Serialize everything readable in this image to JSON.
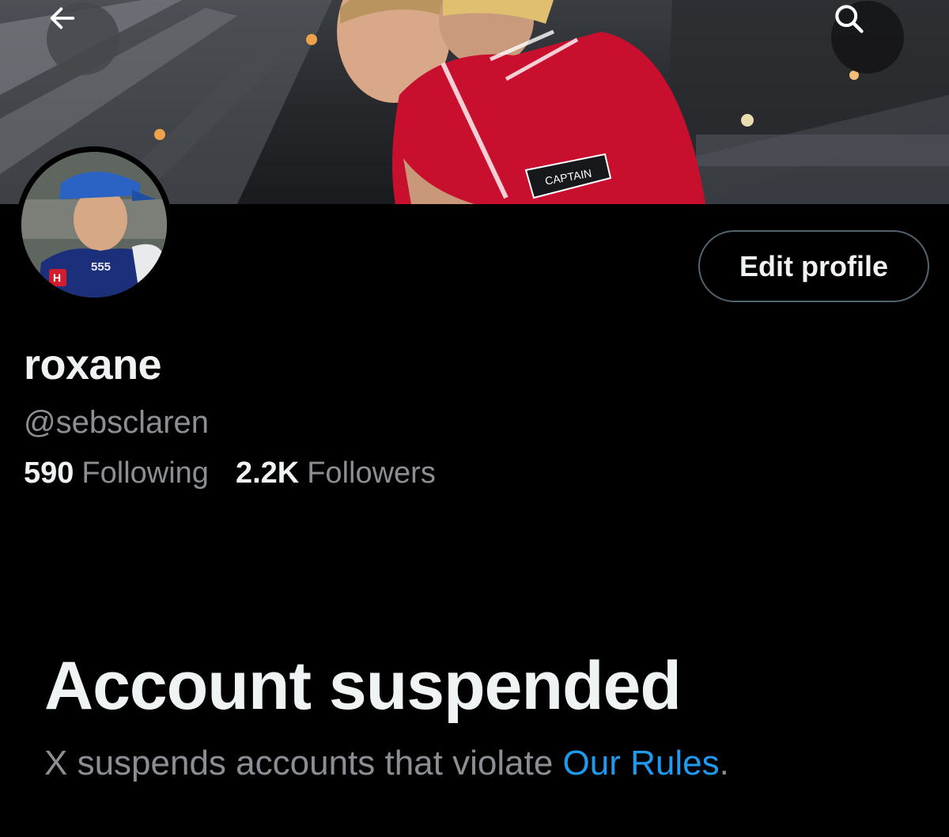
{
  "header": {
    "back_icon": "arrow-left-icon",
    "search_icon": "search-icon"
  },
  "banner": {
    "armband_text": "CAPTAIN",
    "shirt_color": "#c8102e"
  },
  "avatar": {
    "shirt_number": "555"
  },
  "profile": {
    "display_name": "roxane",
    "handle": "@sebsclaren",
    "edit_label": "Edit profile",
    "following_count": "590",
    "following_label": "Following",
    "followers_count": "2.2K",
    "followers_label": "Followers"
  },
  "suspension": {
    "title": "Account suspended",
    "message": "X suspends accounts that violate",
    "link_label": "Our Rules",
    "suffix": "."
  },
  "colors": {
    "background": "#000000",
    "text_primary": "#eff3f4",
    "text_secondary": "#8b8f94",
    "link": "#1d9bf0",
    "border": "#536471"
  }
}
